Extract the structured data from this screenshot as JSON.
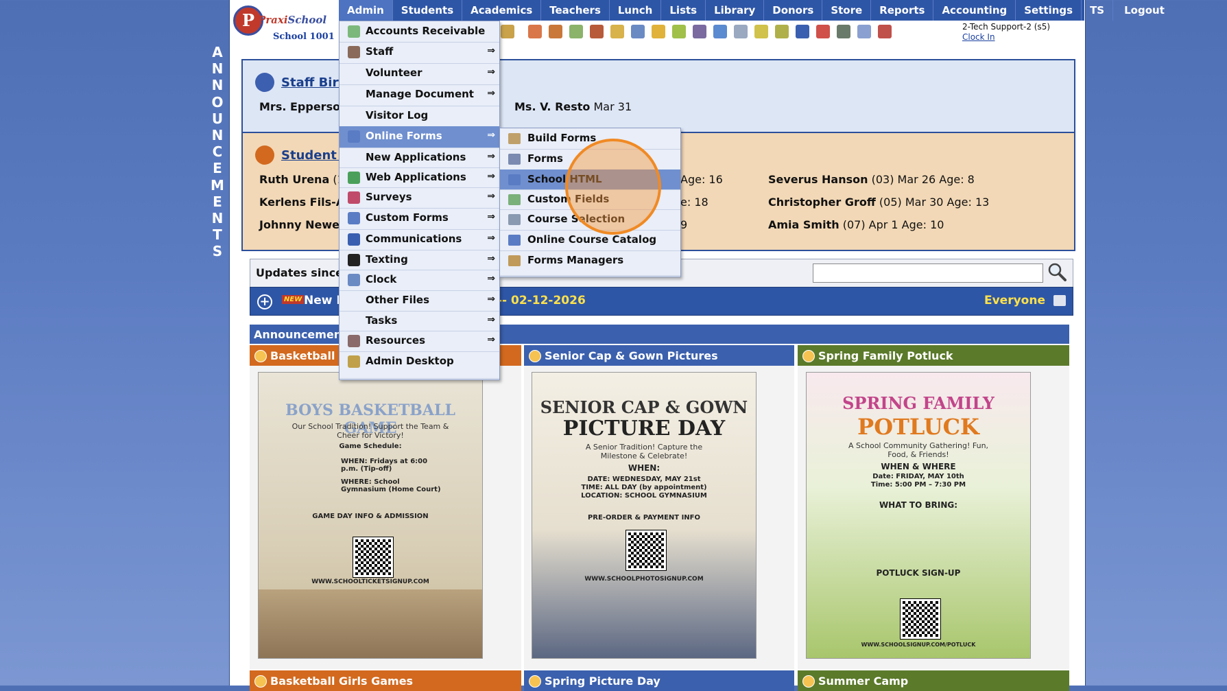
{
  "vertical_label": [
    "A",
    "N",
    "N",
    "O",
    "U",
    "N",
    "C",
    "E",
    "M",
    "E",
    "N",
    "T",
    "S"
  ],
  "logo": {
    "brand_first": "Praxi",
    "brand_second": "School",
    "school": "School 1001"
  },
  "nav": [
    "Admin",
    "Students",
    "Academics",
    "Teachers",
    "Lunch",
    "Lists",
    "Library",
    "Donors",
    "Store",
    "Reports",
    "Accounting",
    "Settings",
    "TS",
    "Logout"
  ],
  "user": {
    "name": "2-Tech Support-2 (s5)",
    "clock_in": "Clock In"
  },
  "staff_birthdays": {
    "title": "Staff Birt",
    "entries": [
      {
        "name": "Mrs. Epperson",
        "date": ""
      },
      {
        "name": "Ms. V. Resto",
        "date": "Mar 31"
      }
    ]
  },
  "student_birthdays": {
    "title": "Student B",
    "col1": [
      {
        "name": "Ruth Urena",
        "info": "(1"
      },
      {
        "name": "Kerlens Fils-A",
        "info": ""
      },
      {
        "name": "Johnny Newe",
        "info": ""
      }
    ],
    "col2": [
      "Age: 16",
      "e: 18",
      "9"
    ],
    "col3": [
      {
        "name": "Severus Hanson",
        "info": "(03) Mar 26 Age: 8"
      },
      {
        "name": "Christopher Groff",
        "info": "(05) Mar 30 Age: 13"
      },
      {
        "name": "Amia Smith",
        "info": "(07) Apr 1 Age: 10"
      }
    ]
  },
  "updates": {
    "label": "Updates since:",
    "new_badge": "NEW",
    "new_text": "New E",
    "date": "-- 02-12-2026",
    "audience": "Everyone"
  },
  "announcements": {
    "header": "Announcements",
    "cards": [
      {
        "title": "Basketball Bo",
        "color": "#d2691e"
      },
      {
        "title": "Senior Cap & Gown Pictures",
        "color": "#3b60ad"
      },
      {
        "title": "Spring Family Potluck",
        "color": "#5b7a2a"
      }
    ],
    "bottom_cards": [
      "Basketball Girls Games",
      "Spring Picture Day",
      "Summer Camp"
    ],
    "posters": [
      {
        "title1": "BOYS BASKETBALL GAME",
        "sub": "Our School Tradition! Support the Team & Cheer for Victory!",
        "info1": "Game Schedule:",
        "info2": "WHEN: Fridays at 6:00 p.m. (Tip-off)",
        "info3": "WHERE: School Gymnasium (Home Court)",
        "info4": "GAME DAY INFO & ADMISSION",
        "url": "WWW.SCHOOLTICKETSIGNUP.COM"
      },
      {
        "title1": "SENIOR CAP & GOWN",
        "title2": "PICTURE DAY",
        "sub": "A Senior Tradition! Capture the Milestone & Celebrate!",
        "info1": "WHEN:",
        "info2": "DATE: WEDNESDAY, MAY 21st",
        "info3": "TIME: ALL DAY (by appointment)",
        "info4": "LOCATION: SCHOOL GYMNASIUM",
        "info5": "PRE-ORDER & PAYMENT INFO",
        "url": "WWW.SCHOOLPHOTOSIGNUP.COM"
      },
      {
        "title1": "SPRING FAMILY",
        "title2": "POTLUCK",
        "sub": "A School Community Gathering! Fun, Food, & Friends!",
        "info1": "WHEN & WHERE",
        "info2": "Date: FRIDAY, MAY 10th",
        "info3": "Time: 5:00 PM – 7:30 PM",
        "info4": "WHAT TO BRING:",
        "info5": "POTLUCK SIGN-UP",
        "url": "WWW.SCHOOLSIGNUP.COM/POTLUCK"
      }
    ]
  },
  "admin_menu": [
    {
      "label": "Accounts Receivable",
      "icon": "money-icon",
      "arrow": false
    },
    {
      "label": "Staff",
      "icon": "staff-icon",
      "arrow": true
    },
    {
      "label": "Volunteer",
      "icon": "",
      "arrow": true
    },
    {
      "label": "Manage Document",
      "icon": "",
      "arrow": true
    },
    {
      "label": "Visitor Log",
      "icon": "",
      "arrow": false
    },
    {
      "label": "Online Forms",
      "icon": "html-icon",
      "arrow": true
    },
    {
      "label": "New Applications",
      "icon": "",
      "arrow": true
    },
    {
      "label": "Web Applications",
      "icon": "globe-icon",
      "arrow": true
    },
    {
      "label": "Surveys",
      "icon": "survey-icon",
      "arrow": true
    },
    {
      "label": "Custom Forms",
      "icon": "html-icon",
      "arrow": true
    },
    {
      "label": "Communications",
      "icon": "at-icon",
      "arrow": true
    },
    {
      "label": "Texting",
      "icon": "phone-icon",
      "arrow": true
    },
    {
      "label": "Clock",
      "icon": "clock-icon",
      "arrow": true
    },
    {
      "label": "Other Files",
      "icon": "",
      "arrow": true
    },
    {
      "label": "Tasks",
      "icon": "",
      "arrow": true
    },
    {
      "label": "Resources",
      "icon": "resources-icon",
      "arrow": true
    },
    {
      "label": "Admin Desktop",
      "icon": "desktop-icon",
      "arrow": false
    }
  ],
  "arrow_glyph": "⇒",
  "online_forms_submenu": [
    "Build Forms",
    "Forms",
    "School HTML",
    "Custom Fields",
    "Course Selection",
    "Online Course Catalog",
    "Forms Managers"
  ]
}
